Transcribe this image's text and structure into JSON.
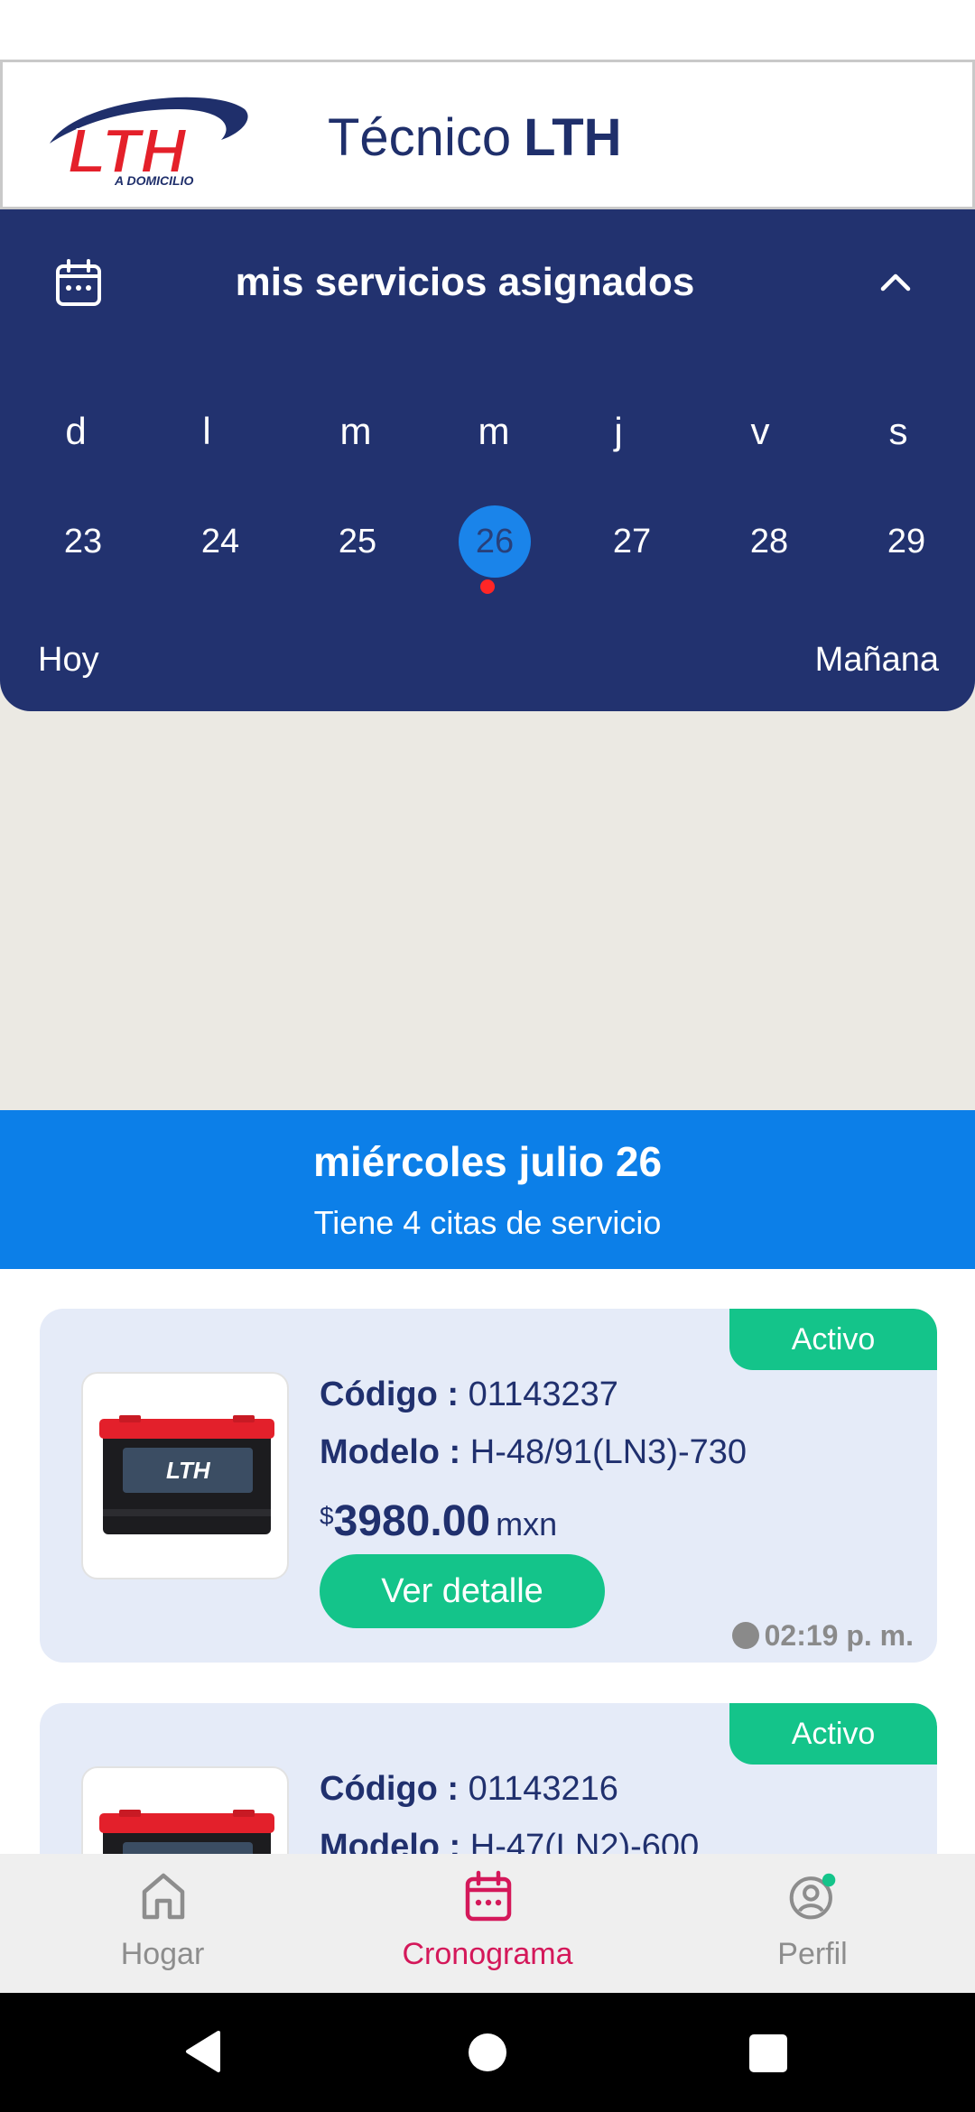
{
  "header": {
    "logo_text": "LTH",
    "logo_tagline": "A DOMICILIO",
    "title_prefix": "Técnico",
    "title_brand": "LTH"
  },
  "calendar": {
    "title": "mis servicios asignados",
    "weekdays": [
      "d",
      "l",
      "m",
      "m",
      "j",
      "v",
      "s"
    ],
    "days": [
      "23",
      "24",
      "25",
      "26",
      "27",
      "28",
      "29"
    ],
    "selected_day": "26",
    "today_label": "Hoy",
    "tomorrow_label": "Mañana"
  },
  "date_banner": {
    "date": "miércoles julio 26",
    "count": "Tiene 4  citas de servicio"
  },
  "appointments": [
    {
      "status": "Activo",
      "code_label": "Código :",
      "code": "01143237",
      "model_label": "Modelo :",
      "model": "H-48/91(LN3)-730",
      "currency_symbol": "$",
      "price": "3980.00",
      "currency": "mxn",
      "action_label": "Ver detalle",
      "time": "02:19 p. m."
    },
    {
      "status": "Activo",
      "code_label": "Código :",
      "code": "01143216",
      "model_label": "Modelo :",
      "model": "H-47(LN2)-600"
    }
  ],
  "bottom_nav": {
    "home": "Hogar",
    "schedule": "Cronograma",
    "profile": "Perfil",
    "active": "schedule"
  },
  "colors": {
    "brand_navy": "#22326f",
    "accent_blue": "#0c7fe8",
    "active_green": "#14c48a",
    "active_tab": "#d4185a",
    "event_dot": "#ff2626"
  }
}
